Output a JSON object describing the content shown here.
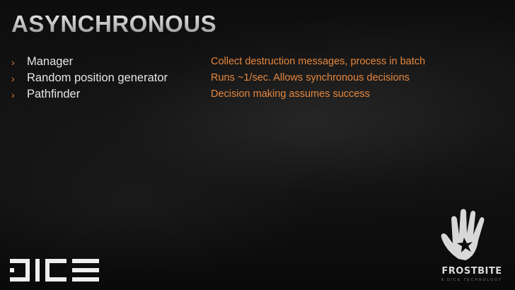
{
  "slide": {
    "title": "ASYNCHRONOUS",
    "left_items": [
      {
        "label": "Manager"
      },
      {
        "label": "Random position generator"
      },
      {
        "label": "Pathfinder"
      }
    ],
    "bullet_glyph": "›",
    "right_lines": [
      "Collect destruction messages, process in batch",
      "Runs ~1/sec. Allows synchronous decisions",
      "Decision making assumes success"
    ]
  },
  "branding": {
    "left_logo": "DICE",
    "right_logo": "FROSTBITE",
    "right_logo_tagline": "A DICE TECHNOLOGY",
    "icons": [
      "dice-logo",
      "frostbite-hand-icon"
    ]
  },
  "colors": {
    "accent": "#e5873f",
    "text": "#e6e6e6",
    "background": "#0b0b0b"
  }
}
